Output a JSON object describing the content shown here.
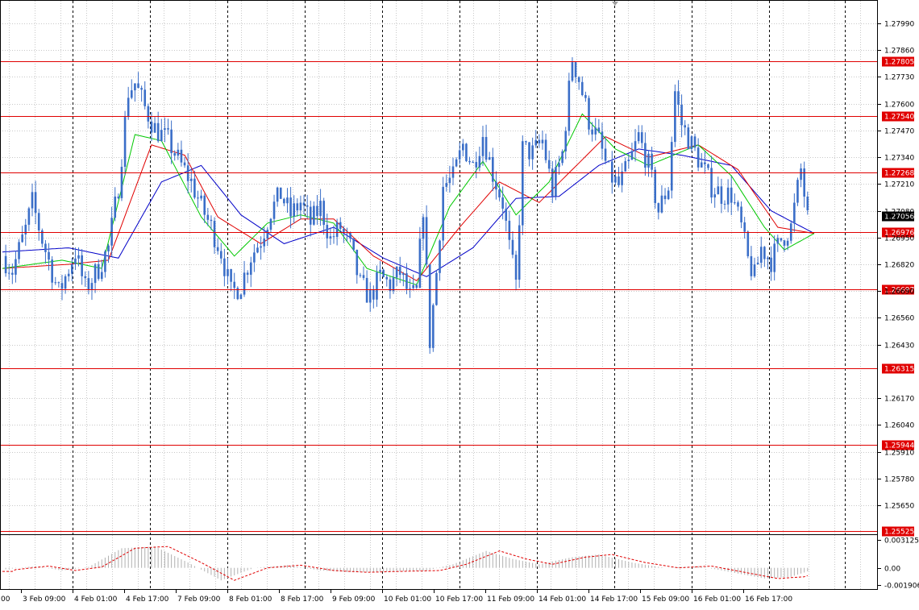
{
  "chart_data": [
    {
      "type": "candlestick",
      "ylim": [
        1.2551,
        1.2805
      ],
      "price_ticks": [
        "1.27990",
        "1.27860",
        "1.27730",
        "1.27600",
        "1.27470",
        "1.27340",
        "1.27210",
        "1.27080",
        "1.26950",
        "1.26820",
        "1.26690",
        "1.26560",
        "1.26430",
        "1.26170",
        "1.26040",
        "1.25910",
        "1.25780",
        "1.25650"
      ],
      "current_price": "1.27056",
      "levels": [
        "1.27805",
        "1.27540",
        "1.27268",
        "1.26976",
        "1.26697",
        "1.26315",
        "1.25944",
        "1.25525"
      ],
      "x_ticks": [
        "3 Feb 09:00",
        "4 Feb 01:00",
        "4 Feb 17:00",
        "7 Feb 09:00",
        "8 Feb 01:00",
        "8 Feb 17:00",
        "9 Feb 09:00",
        "10 Feb 01:00",
        "10 Feb 17:00",
        "11 Feb 09:00",
        "14 Feb 01:00",
        "14 Feb 17:00",
        "15 Feb 09:00",
        "16 Feb 01:00",
        "16 Feb 17:00"
      ],
      "x_tick_edge": ":00",
      "close_path": [
        [
          0,
          1.2686
        ],
        [
          3,
          1.2679
        ],
        [
          7,
          1.2699
        ],
        [
          9,
          1.2712
        ],
        [
          12,
          1.2694
        ],
        [
          17,
          1.2668
        ],
        [
          22,
          1.2688
        ],
        [
          25,
          1.267
        ],
        [
          29,
          1.268
        ],
        [
          32,
          1.269
        ],
        [
          35,
          1.272
        ],
        [
          38,
          1.2766
        ],
        [
          40,
          1.277
        ],
        [
          43,
          1.2758
        ],
        [
          46,
          1.2748
        ],
        [
          50,
          1.2742
        ],
        [
          54,
          1.273
        ],
        [
          57,
          1.2722
        ],
        [
          60,
          1.271
        ],
        [
          63,
          1.27
        ],
        [
          66,
          1.2688
        ],
        [
          69,
          1.2668
        ],
        [
          72,
          1.2672
        ],
        [
          75,
          1.2686
        ],
        [
          78,
          1.2694
        ],
        [
          81,
          1.2708
        ],
        [
          84,
          1.2716
        ],
        [
          87,
          1.2706
        ],
        [
          90,
          1.2712
        ],
        [
          93,
          1.2702
        ],
        [
          96,
          1.271
        ],
        [
          99,
          1.2694
        ],
        [
          102,
          1.27
        ],
        [
          105,
          1.269
        ],
        [
          108,
          1.2672
        ],
        [
          111,
          1.2666
        ],
        [
          114,
          1.2676
        ],
        [
          117,
          1.2672
        ],
        [
          120,
          1.2678
        ],
        [
          123,
          1.2666
        ],
        [
          125,
          1.2668
        ],
        [
          127,
          1.271
        ],
        [
          129,
          1.2645
        ],
        [
          131,
          1.2678
        ],
        [
          133,
          1.272
        ],
        [
          136,
          1.2724
        ],
        [
          139,
          1.274
        ],
        [
          142,
          1.273
        ],
        [
          145,
          1.2745
        ],
        [
          148,
          1.2726
        ],
        [
          151,
          1.2712
        ],
        [
          153,
          1.269
        ],
        [
          155,
          1.2672
        ],
        [
          157,
          1.2738
        ],
        [
          160,
          1.2736
        ],
        [
          163,
          1.2742
        ],
        [
          166,
          1.2718
        ],
        [
          169,
          1.2736
        ],
        [
          172,
          1.2782
        ],
        [
          174,
          1.2772
        ],
        [
          177,
          1.2752
        ],
        [
          180,
          1.2742
        ],
        [
          183,
          1.2726
        ],
        [
          186,
          1.272
        ],
        [
          189,
          1.273
        ],
        [
          192,
          1.2744
        ],
        [
          195,
          1.273
        ],
        [
          198,
          1.2708
        ],
        [
          201,
          1.272
        ],
        [
          203,
          1.2766
        ],
        [
          205,
          1.275
        ],
        [
          208,
          1.274
        ],
        [
          211,
          1.273
        ],
        [
          214,
          1.272
        ],
        [
          217,
          1.2716
        ],
        [
          220,
          1.2716
        ],
        [
          223,
          1.27
        ],
        [
          225,
          1.2684
        ],
        [
          227,
          1.2676
        ],
        [
          229,
          1.269
        ],
        [
          232,
          1.2684
        ],
        [
          235,
          1.2694
        ],
        [
          238,
          1.27
        ],
        [
          241,
          1.2728
        ],
        [
          243,
          1.2704
        ]
      ],
      "ma_fast": [
        [
          0,
          1.268
        ],
        [
          18,
          1.2684
        ],
        [
          30,
          1.268
        ],
        [
          40,
          1.2745
        ],
        [
          48,
          1.2742
        ],
        [
          60,
          1.2705
        ],
        [
          70,
          1.2686
        ],
        [
          80,
          1.2702
        ],
        [
          90,
          1.2706
        ],
        [
          100,
          1.2702
        ],
        [
          110,
          1.268
        ],
        [
          125,
          1.2672
        ],
        [
          135,
          1.271
        ],
        [
          145,
          1.2732
        ],
        [
          155,
          1.2706
        ],
        [
          165,
          1.2722
        ],
        [
          175,
          1.2755
        ],
        [
          185,
          1.2738
        ],
        [
          195,
          1.273
        ],
        [
          210,
          1.274
        ],
        [
          220,
          1.2725
        ],
        [
          230,
          1.27
        ],
        [
          236,
          1.2689
        ],
        [
          245,
          1.2697
        ]
      ],
      "ma_mid": [
        [
          0,
          1.268
        ],
        [
          20,
          1.2682
        ],
        [
          32,
          1.2684
        ],
        [
          45,
          1.274
        ],
        [
          55,
          1.2735
        ],
        [
          65,
          1.2705
        ],
        [
          78,
          1.2692
        ],
        [
          90,
          1.2704
        ],
        [
          100,
          1.2704
        ],
        [
          112,
          1.2686
        ],
        [
          125,
          1.2674
        ],
        [
          138,
          1.27
        ],
        [
          150,
          1.2722
        ],
        [
          162,
          1.2712
        ],
        [
          172,
          1.2728
        ],
        [
          182,
          1.2744
        ],
        [
          195,
          1.2734
        ],
        [
          210,
          1.274
        ],
        [
          222,
          1.2728
        ],
        [
          234,
          1.27
        ],
        [
          245,
          1.2697
        ]
      ],
      "ma_slow": [
        [
          0,
          1.2688
        ],
        [
          20,
          1.269
        ],
        [
          35,
          1.2685
        ],
        [
          48,
          1.2722
        ],
        [
          60,
          1.273
        ],
        [
          72,
          1.2706
        ],
        [
          85,
          1.2692
        ],
        [
          100,
          1.27
        ],
        [
          115,
          1.2685
        ],
        [
          128,
          1.2676
        ],
        [
          142,
          1.269
        ],
        [
          155,
          1.2714
        ],
        [
          168,
          1.2715
        ],
        [
          180,
          1.273
        ],
        [
          192,
          1.2738
        ],
        [
          205,
          1.2735
        ],
        [
          220,
          1.273
        ],
        [
          232,
          1.2708
        ],
        [
          245,
          1.2697
        ]
      ],
      "osc_ticks": [
        "0.003125",
        "0.00",
        "-0.001906"
      ],
      "osc_ylim": [
        -0.0022,
        0.0035
      ],
      "osc_path": [
        [
          0,
          -0.0002
        ],
        [
          10,
          0.0002
        ],
        [
          18,
          -0.0003
        ],
        [
          26,
          0.0001
        ],
        [
          36,
          0.0022
        ],
        [
          46,
          0.0024
        ],
        [
          56,
          0.0006
        ],
        [
          66,
          -0.0014
        ],
        [
          76,
          0.0
        ],
        [
          86,
          0.0003
        ],
        [
          96,
          -0.0003
        ],
        [
          106,
          -0.0005
        ],
        [
          116,
          -0.0004
        ],
        [
          128,
          -0.0003
        ],
        [
          136,
          0.0004
        ],
        [
          146,
          0.0019
        ],
        [
          154,
          0.001
        ],
        [
          162,
          0.0004
        ],
        [
          172,
          0.0012
        ],
        [
          180,
          0.0015
        ],
        [
          190,
          0.0006
        ],
        [
          200,
          0.0
        ],
        [
          210,
          0.0002
        ],
        [
          220,
          -0.0005
        ],
        [
          230,
          -0.0012
        ],
        [
          238,
          -0.001
        ],
        [
          243,
          -0.0004
        ]
      ]
    }
  ]
}
